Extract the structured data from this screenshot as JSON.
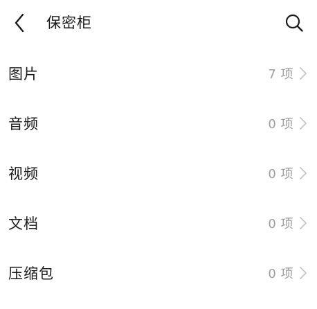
{
  "header": {
    "title": "保密柜",
    "back_icon": "chevron-left-icon",
    "search_icon": "search-icon"
  },
  "list": {
    "items": [
      {
        "label": "图片",
        "count": "7 项"
      },
      {
        "label": "音频",
        "count": "0 项"
      },
      {
        "label": "视频",
        "count": "0 项"
      },
      {
        "label": "文档",
        "count": "0 项"
      },
      {
        "label": "压缩包",
        "count": "0 项"
      }
    ]
  },
  "colors": {
    "background": "#ffffff",
    "text_primary": "#1a1a1a",
    "text_secondary": "#9e9e9e",
    "chevron": "#c4c4c4"
  }
}
